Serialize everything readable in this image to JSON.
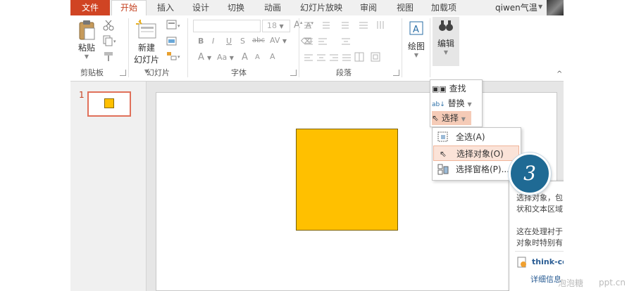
{
  "tabs": [
    {
      "label": "文件"
    },
    {
      "label": "开始"
    },
    {
      "label": "插入"
    },
    {
      "label": "设计"
    },
    {
      "label": "切换"
    },
    {
      "label": "动画"
    },
    {
      "label": "幻灯片放映"
    },
    {
      "label": "审阅"
    },
    {
      "label": "视图"
    },
    {
      "label": "加载项"
    }
  ],
  "user": {
    "name": "qiwen气温"
  },
  "ribbon": {
    "clipboard": {
      "paste_label": "粘贴",
      "group_label": "剪贴板"
    },
    "slides": {
      "new_slide_line1": "新建",
      "new_slide_line2": "幻灯片",
      "group_label": "幻灯片"
    },
    "font": {
      "size": "18",
      "group_label": "字体",
      "bold": "B",
      "italic": "I",
      "underline": "U",
      "shadow": "S",
      "strike": "abc",
      "spacing": "AV",
      "color": "A",
      "case": "Aa",
      "grow": "A",
      "shrink": "A",
      "clear": "A"
    },
    "paragraph": {
      "group_label": "段落"
    },
    "drawing": {
      "label": "绘图"
    },
    "editing": {
      "label": "编辑"
    }
  },
  "slides_pane": {
    "slide_number": "1"
  },
  "edit_menu": {
    "find": "查找",
    "replace": "替换",
    "select": "选择"
  },
  "select_menu": {
    "select_all": "全选(A)",
    "select_objects": "选择对象(O)",
    "selection_pane": "选择窗格(P)..."
  },
  "tooltip": {
    "line1": "选择对象，包",
    "line2": "状和文本区域",
    "line3": "这在处理衬于",
    "line4": "对象时特别有",
    "link": "think-ce",
    "more": "详细信息"
  },
  "step_badge": "3",
  "watermark": {
    "text": "泡泡糖",
    "site": "ppt.cn"
  },
  "colors": {
    "accent": "#c4401f",
    "file_tab": "#d04423",
    "shape_fill": "#ffc000",
    "badge": "#1f6a94",
    "highlight": "#f5cbb7"
  }
}
